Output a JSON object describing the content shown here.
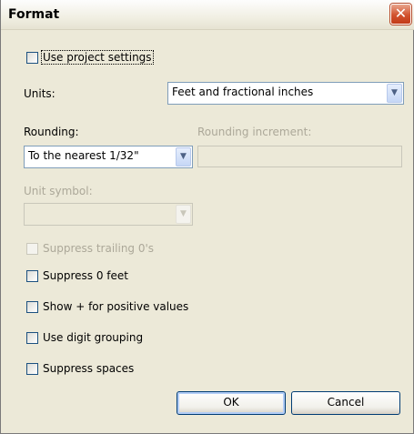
{
  "title": "Format",
  "use_project_settings": {
    "label": "Use project settings",
    "checked": false
  },
  "units": {
    "label": "Units:",
    "value": "Feet and fractional inches"
  },
  "rounding": {
    "label": "Rounding:",
    "value": "To the nearest 1/32\""
  },
  "rounding_increment": {
    "label": "Rounding increment:",
    "value": ""
  },
  "unit_symbol": {
    "label": "Unit symbol:",
    "value": ""
  },
  "options": [
    {
      "label": "Suppress trailing 0's",
      "checked": false,
      "enabled": false
    },
    {
      "label": "Suppress 0 feet",
      "checked": false,
      "enabled": true
    },
    {
      "label": "Show + for positive values",
      "checked": false,
      "enabled": true
    },
    {
      "label": "Use digit grouping",
      "checked": false,
      "enabled": true
    },
    {
      "label": "Suppress spaces",
      "checked": false,
      "enabled": true
    }
  ],
  "buttons": {
    "ok": "OK",
    "cancel": "Cancel"
  },
  "icons": {
    "close": "close-icon",
    "dropdown": "chevron-down-icon"
  },
  "colors": {
    "close_button": "#d2532f",
    "input_border": "#7f9db9",
    "dialog_bg": "#ece9d8"
  }
}
